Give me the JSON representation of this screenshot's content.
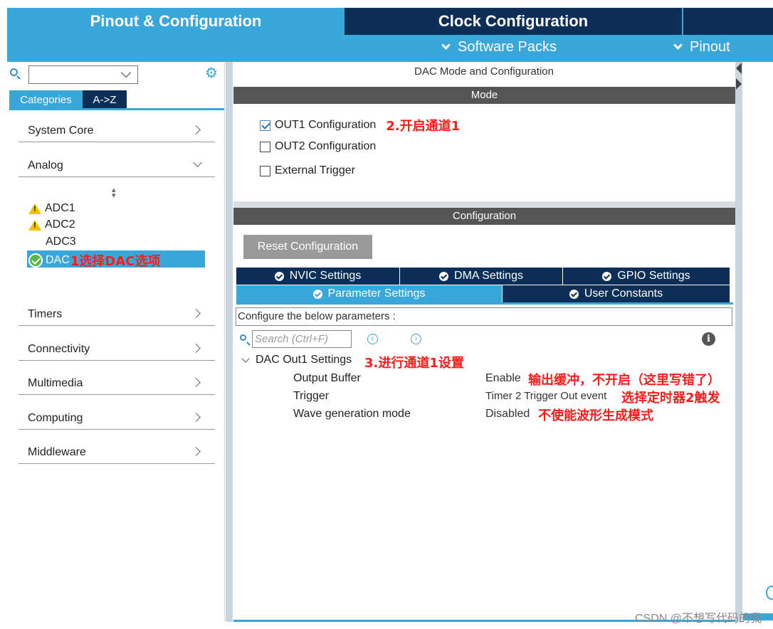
{
  "top_tabs": {
    "pinout_config": "Pinout & Configuration",
    "clock_config": "Clock Configuration"
  },
  "sub_menu": {
    "software_packs": "Software Packs",
    "pinout": "Pinout"
  },
  "left": {
    "search_placeholder": "",
    "tabs": {
      "categories": "Categories",
      "az": "A->Z"
    },
    "categories": {
      "system_core": "System Core",
      "analog": "Analog",
      "timers": "Timers",
      "connectivity": "Connectivity",
      "multimedia": "Multimedia",
      "computing": "Computing",
      "middleware": "Middleware"
    },
    "peripherals": {
      "adc1": "ADC1",
      "adc2": "ADC2",
      "adc3": "ADC3",
      "dac": "DAC"
    },
    "note_dac": "1选择DAC选项"
  },
  "mode": {
    "title": "DAC Mode and Configuration",
    "section_label": "Mode",
    "out1": "OUT1 Configuration",
    "out1_checked": true,
    "out2": "OUT2 Configuration",
    "out2_checked": false,
    "ext_trigger": "External Trigger",
    "ext_trigger_checked": false,
    "note_out1": "2.开启通道1"
  },
  "configuration": {
    "section_label": "Configuration",
    "reset_button": "Reset Configuration",
    "tabs": {
      "nvic": "NVIC Settings",
      "dma": "DMA Settings",
      "gpio": "GPIO Settings",
      "parameter": "Parameter Settings",
      "user_constants": "User Constants"
    },
    "description": "Configure the below parameters :",
    "search_placeholder": "Search (Ctrl+F)",
    "group_label": "DAC Out1 Settings",
    "note_group": "3.进行通道1设置",
    "params": {
      "output_buffer": {
        "label": "Output Buffer",
        "value": "Enable",
        "note": "输出缓冲，不开启（这里写错了）"
      },
      "trigger": {
        "label": "Trigger",
        "value": "Timer 2 Trigger Out event",
        "note": "选择定时器2触发"
      },
      "wave": {
        "label": "Wave generation mode",
        "value": "Disabled",
        "note": "不使能波形生成模式"
      }
    }
  },
  "watermark": "CSDN @不想写代码的我"
}
